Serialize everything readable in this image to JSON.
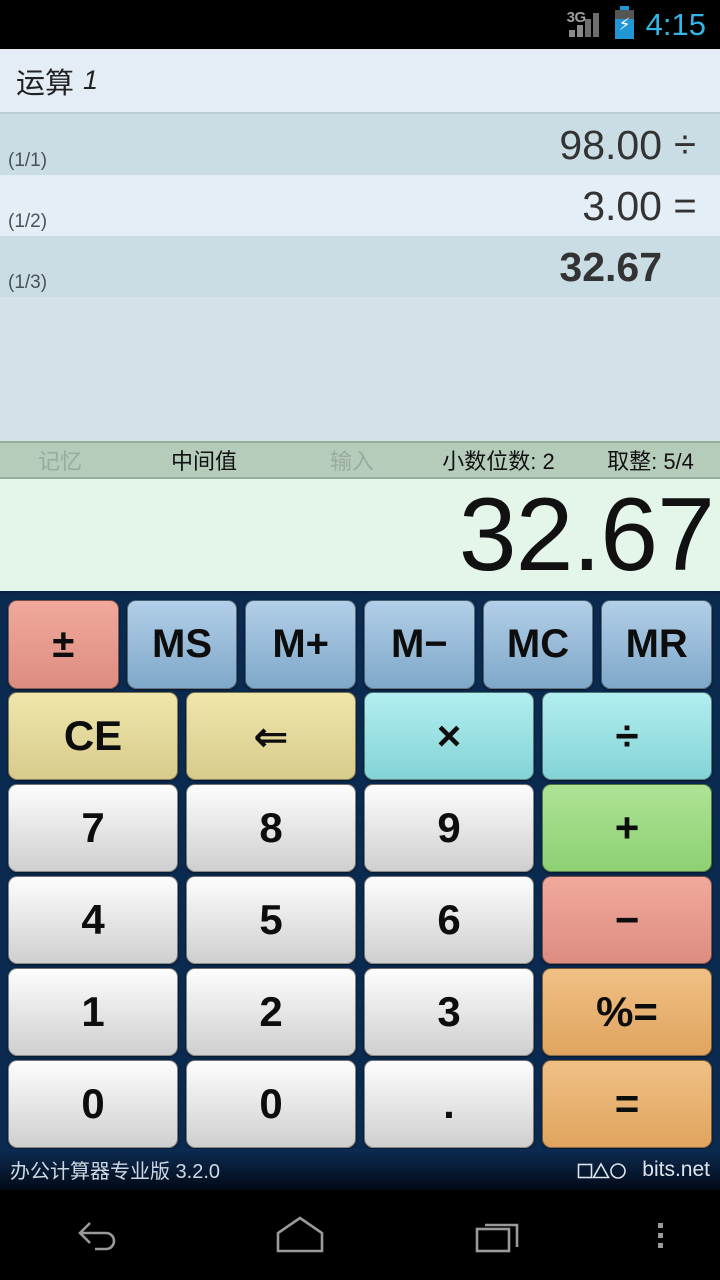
{
  "statusbar": {
    "network": "3G",
    "time": "4:15",
    "battery_icon": "battery-charging-icon",
    "signal_icon": "signal-bars-icon"
  },
  "titlebar": {
    "label": "运算",
    "number": "1"
  },
  "calculation_rows": [
    {
      "index": "(1/1)",
      "value": "98.00",
      "operator": "÷",
      "bold": false
    },
    {
      "index": "(1/2)",
      "value": "3.00",
      "operator": "=",
      "bold": false
    },
    {
      "index": "(1/3)",
      "value": "32.67",
      "operator": "",
      "bold": true
    }
  ],
  "infobar": {
    "memory": "记忆",
    "intermediate": "中间值",
    "input": "输入",
    "decimals": "小数位数: 2",
    "rounding": "取整: 5/4"
  },
  "display": {
    "value": "32.67"
  },
  "keypad": {
    "memory_row": [
      {
        "label": "±",
        "name": "plus-minus-key",
        "style": "g-red"
      },
      {
        "label": "MS",
        "name": "memory-store-key",
        "style": "g-blue"
      },
      {
        "label": "M+",
        "name": "memory-add-key",
        "style": "g-blue"
      },
      {
        "label": "M−",
        "name": "memory-subtract-key",
        "style": "g-blue"
      },
      {
        "label": "MC",
        "name": "memory-clear-key",
        "style": "g-blue"
      },
      {
        "label": "MR",
        "name": "memory-recall-key",
        "style": "g-blue"
      }
    ],
    "rows": [
      [
        {
          "label": "CE",
          "name": "clear-entry-key",
          "style": "g-yel"
        },
        {
          "label": "⇐",
          "name": "backspace-key",
          "style": "g-yel"
        },
        {
          "label": "×",
          "name": "multiply-key",
          "style": "g-cyan"
        },
        {
          "label": "÷",
          "name": "divide-key",
          "style": "g-cyan"
        }
      ],
      [
        {
          "label": "7",
          "name": "digit-7-key",
          "style": "g-white"
        },
        {
          "label": "8",
          "name": "digit-8-key",
          "style": "g-white"
        },
        {
          "label": "9",
          "name": "digit-9-key",
          "style": "g-white"
        },
        {
          "label": "+",
          "name": "add-key",
          "style": "g-green"
        }
      ],
      [
        {
          "label": "4",
          "name": "digit-4-key",
          "style": "g-white"
        },
        {
          "label": "5",
          "name": "digit-5-key",
          "style": "g-white"
        },
        {
          "label": "6",
          "name": "digit-6-key",
          "style": "g-white"
        },
        {
          "label": "−",
          "name": "subtract-key",
          "style": "g-pink"
        }
      ],
      [
        {
          "label": "1",
          "name": "digit-1-key",
          "style": "g-white"
        },
        {
          "label": "2",
          "name": "digit-2-key",
          "style": "g-white"
        },
        {
          "label": "3",
          "name": "digit-3-key",
          "style": "g-white"
        },
        {
          "label": "%=",
          "name": "percent-equals-key",
          "style": "g-org"
        }
      ],
      [
        {
          "label": "0",
          "name": "digit-0-key",
          "style": "g-white"
        },
        {
          "label": "0",
          "name": "digit-0-alt-key",
          "style": "g-white"
        },
        {
          "label": ".",
          "name": "decimal-point-key",
          "style": "g-white"
        },
        {
          "label": "=",
          "name": "equals-key",
          "style": "g-org"
        }
      ]
    ]
  },
  "footer": {
    "app_name": "办公计算器专业版  3.2.0",
    "brand": "bits.net"
  },
  "navbar": {
    "back": "back-icon",
    "home": "home-icon",
    "recents": "recent-apps-icon",
    "menu": "overflow-menu-icon"
  },
  "colors": {
    "accent_blue": "#33b5e5",
    "keypad_bg": "#0b2a50",
    "display_bg": "#e4f5e9",
    "infobar_bg": "#b5ccbb",
    "list_bg": "#d4e2e8"
  }
}
